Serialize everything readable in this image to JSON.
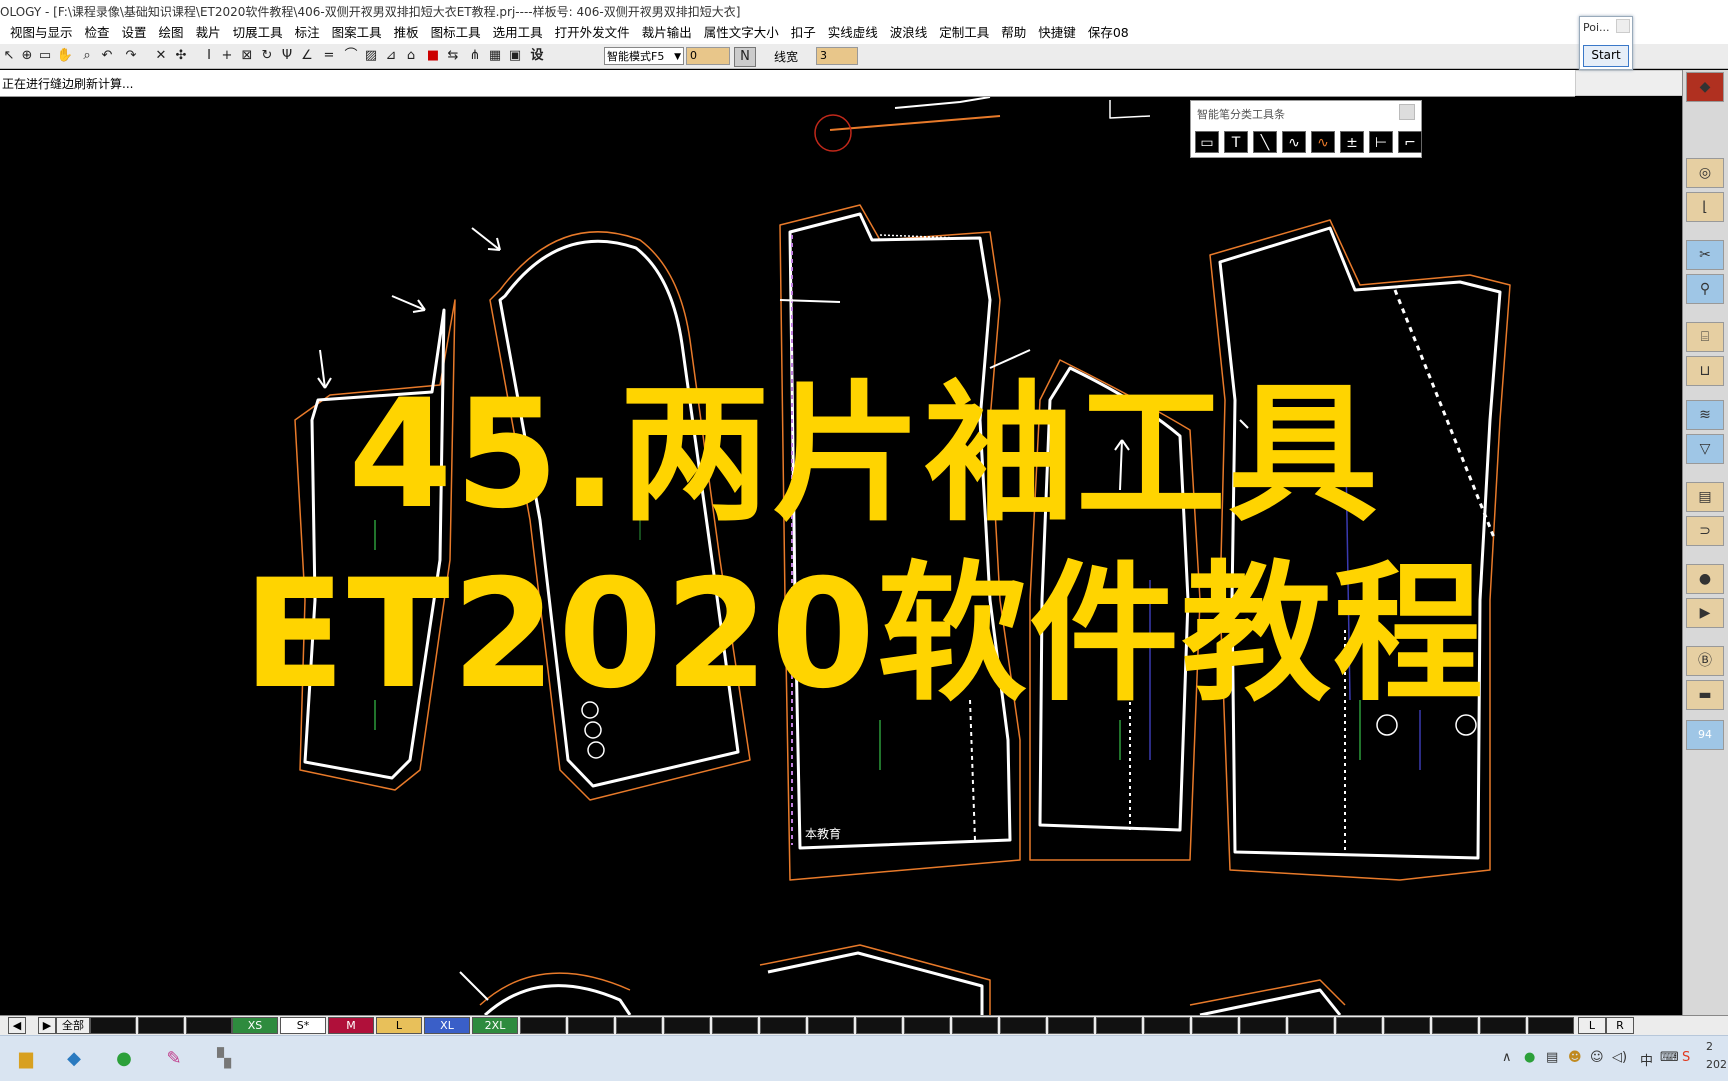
{
  "window": {
    "title": "OLOGY - [F:\\课程录像\\基础知识课程\\ET2020软件教程\\406-双侧开衩男双排扣短大衣ET教程.prj----样板号: 406-双侧开衩男双排扣短大衣]"
  },
  "menu": [
    "视图与显示",
    "检查",
    "设置",
    "绘图",
    "裁片",
    "切展工具",
    "标注",
    "图案工具",
    "推板",
    "图标工具",
    "选用工具",
    "打开外发文件",
    "裁片输出",
    "属性文字大小",
    "扣子",
    "实线虚线",
    "波浪线",
    "定制工具",
    "帮助",
    "快捷键",
    "保存08"
  ],
  "toolbar": {
    "mode_select": "智能模式F5",
    "input1_value": "0",
    "set_label": "设",
    "line_width_label": "线宽",
    "line_width_value": "3"
  },
  "status": {
    "text": "正在进行缝边刷新计算..."
  },
  "smart_toolbar": {
    "title": "智能笔分类工具条",
    "tools": [
      "rect-icon",
      "text-icon",
      "line-icon",
      "curve-icon",
      "wave-icon",
      "dash-icon",
      "measure-icon",
      "corner-icon"
    ]
  },
  "poi_popup": {
    "label": "Poi...",
    "start": "Start"
  },
  "overlay": {
    "line1": "45.两片袖工具",
    "line2": "ET2020软件教程"
  },
  "canvas_labels": {
    "watermark": "本教育",
    "right_panel_number": "94"
  },
  "size_bar": {
    "all_label": "全部",
    "sizes": [
      {
        "label": "XS",
        "color": "#2e8b3e"
      },
      {
        "label": "S*",
        "color": "#ffffff"
      },
      {
        "label": "M",
        "color": "#b0103a"
      },
      {
        "label": "L",
        "color": "#e8c05a"
      },
      {
        "label": "XL",
        "color": "#3a5fc8"
      },
      {
        "label": "2XL",
        "color": "#2e8b3e"
      }
    ],
    "L": "L",
    "R": "R"
  },
  "taskbar": {
    "clock_top": "2",
    "clock_bottom": "202"
  }
}
